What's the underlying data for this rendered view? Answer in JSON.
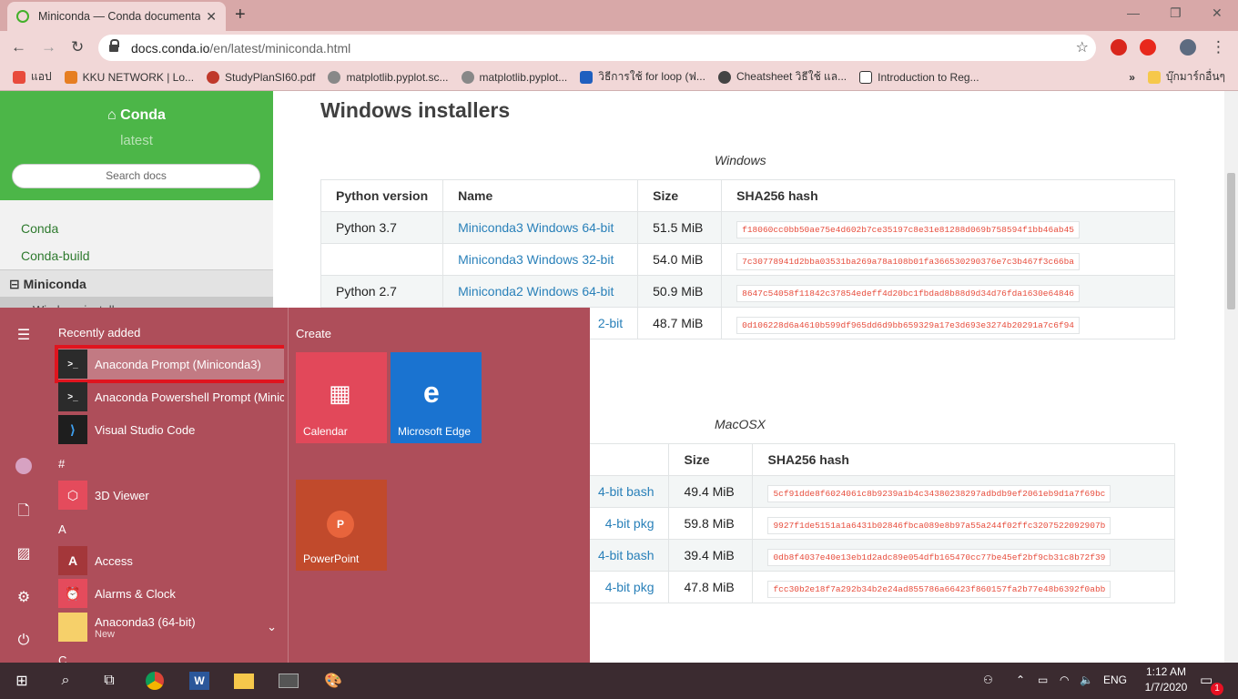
{
  "browser": {
    "tab_title": "Miniconda — Conda documentat",
    "url_host": "docs.conda.io",
    "url_path": "/en/latest/miniconda.html",
    "bookmarks": [
      {
        "label": "แอป",
        "color": "#e84b3c"
      },
      {
        "label": "KKU NETWORK | Lo...",
        "color": "#e67e22"
      },
      {
        "label": "StudyPlanSI60.pdf",
        "color": "#c0392b"
      },
      {
        "label": "matplotlib.pyplot.sc...",
        "color": "#555"
      },
      {
        "label": "matplotlib.pyplot...",
        "color": "#555"
      },
      {
        "label": "วิธีการใช้ for loop (ฟ...",
        "color": "#1f5fbf"
      },
      {
        "label": "Cheatsheet วิธีใช้ แล...",
        "color": "#444"
      },
      {
        "label": "Introduction to Reg...",
        "color": "#333"
      }
    ],
    "more": "»",
    "other_bookmarks": "บุ๊กมาร์กอื่นๆ"
  },
  "sidebar": {
    "brand": "Conda",
    "version": "latest",
    "search_placeholder": "Search docs",
    "items": [
      "Conda",
      "Conda-build"
    ],
    "current": "Miniconda",
    "sub": "Windows installers"
  },
  "content": {
    "heading": "Windows installers",
    "windows_caption": "Windows",
    "macosx_caption": "MacOSX",
    "windows_headers": [
      "Python version",
      "Name",
      "Size",
      "SHA256 hash"
    ],
    "windows_rows": [
      {
        "py": "Python 3.7",
        "name": "Miniconda3 Windows 64-bit",
        "size": "51.5 MiB",
        "hash": "f18060cc0bb50ae75e4d602b7ce35197c8e31e81288d069b758594f1bb46ab45"
      },
      {
        "py": "",
        "name": "Miniconda3 Windows 32-bit",
        "size": "54.0 MiB",
        "hash": "7c30778941d2bba03531ba269a78a108b01fa366530290376e7c3b467f3c66ba"
      },
      {
        "py": "Python 2.7",
        "name": "Miniconda2 Windows 64-bit",
        "size": "50.9 MiB",
        "hash": "8647c54058f11842c37854edeff4d20bc1fbdad8b88d9d34d76fda1630e64846"
      },
      {
        "py": "",
        "name": "2-bit",
        "size": "48.7 MiB",
        "hash": "0d106228d6a4610b599df965dd6d9bb659329a17e3d693e3274b20291a7c6f94"
      }
    ],
    "mac_headers": [
      "Size",
      "SHA256 hash"
    ],
    "mac_rows": [
      {
        "name": "4-bit bash",
        "size": "49.4 MiB",
        "hash": "5cf91dde8f6024061c8b9239a1b4c34380238297adbdb9ef2061eb9d1a7f69bc"
      },
      {
        "name": "4-bit pkg",
        "size": "59.8 MiB",
        "hash": "9927f1de5151a1a6431b02846fbca089e8b97a55a244f02ffc3207522092907b"
      },
      {
        "name": "4-bit bash",
        "size": "39.4 MiB",
        "hash": "0db8f4037e40e13eb1d2adc89e054dfb165470cc77be45ef2bf9cb31c8b72f39"
      },
      {
        "name": "4-bit pkg",
        "size": "47.8 MiB",
        "hash": "fcc30b2e18f7a292b34b2e24ad855786a66423f860157fa2b77e48b6392f0abb"
      }
    ]
  },
  "startmenu": {
    "recently_added": "Recently added",
    "create": "Create",
    "apps": [
      {
        "label": "Anaconda Prompt (Miniconda3)",
        "icon_color": "#2b2b2b",
        "glyph": ">_"
      },
      {
        "label": "Anaconda Powershell Prompt (Minic...",
        "icon_color": "#2b2b2b",
        "glyph": ">_"
      },
      {
        "label": "Visual Studio Code",
        "icon_color": "#1e1e1e",
        "glyph": "⟩"
      }
    ],
    "letter_hash": "#",
    "viewer": "3D Viewer",
    "letter_a": "A",
    "access": "Access",
    "alarms": "Alarms & Clock",
    "anaconda": "Anaconda3 (64-bit)",
    "anaconda_new": "New",
    "letter_c": "C",
    "tiles": {
      "calendar": "Calendar",
      "edge": "Microsoft Edge",
      "powerpoint": "PowerPoint"
    }
  },
  "taskbar": {
    "lang": "ENG",
    "time": "1:12 AM",
    "date": "1/7/2020",
    "notif_count": "1"
  }
}
